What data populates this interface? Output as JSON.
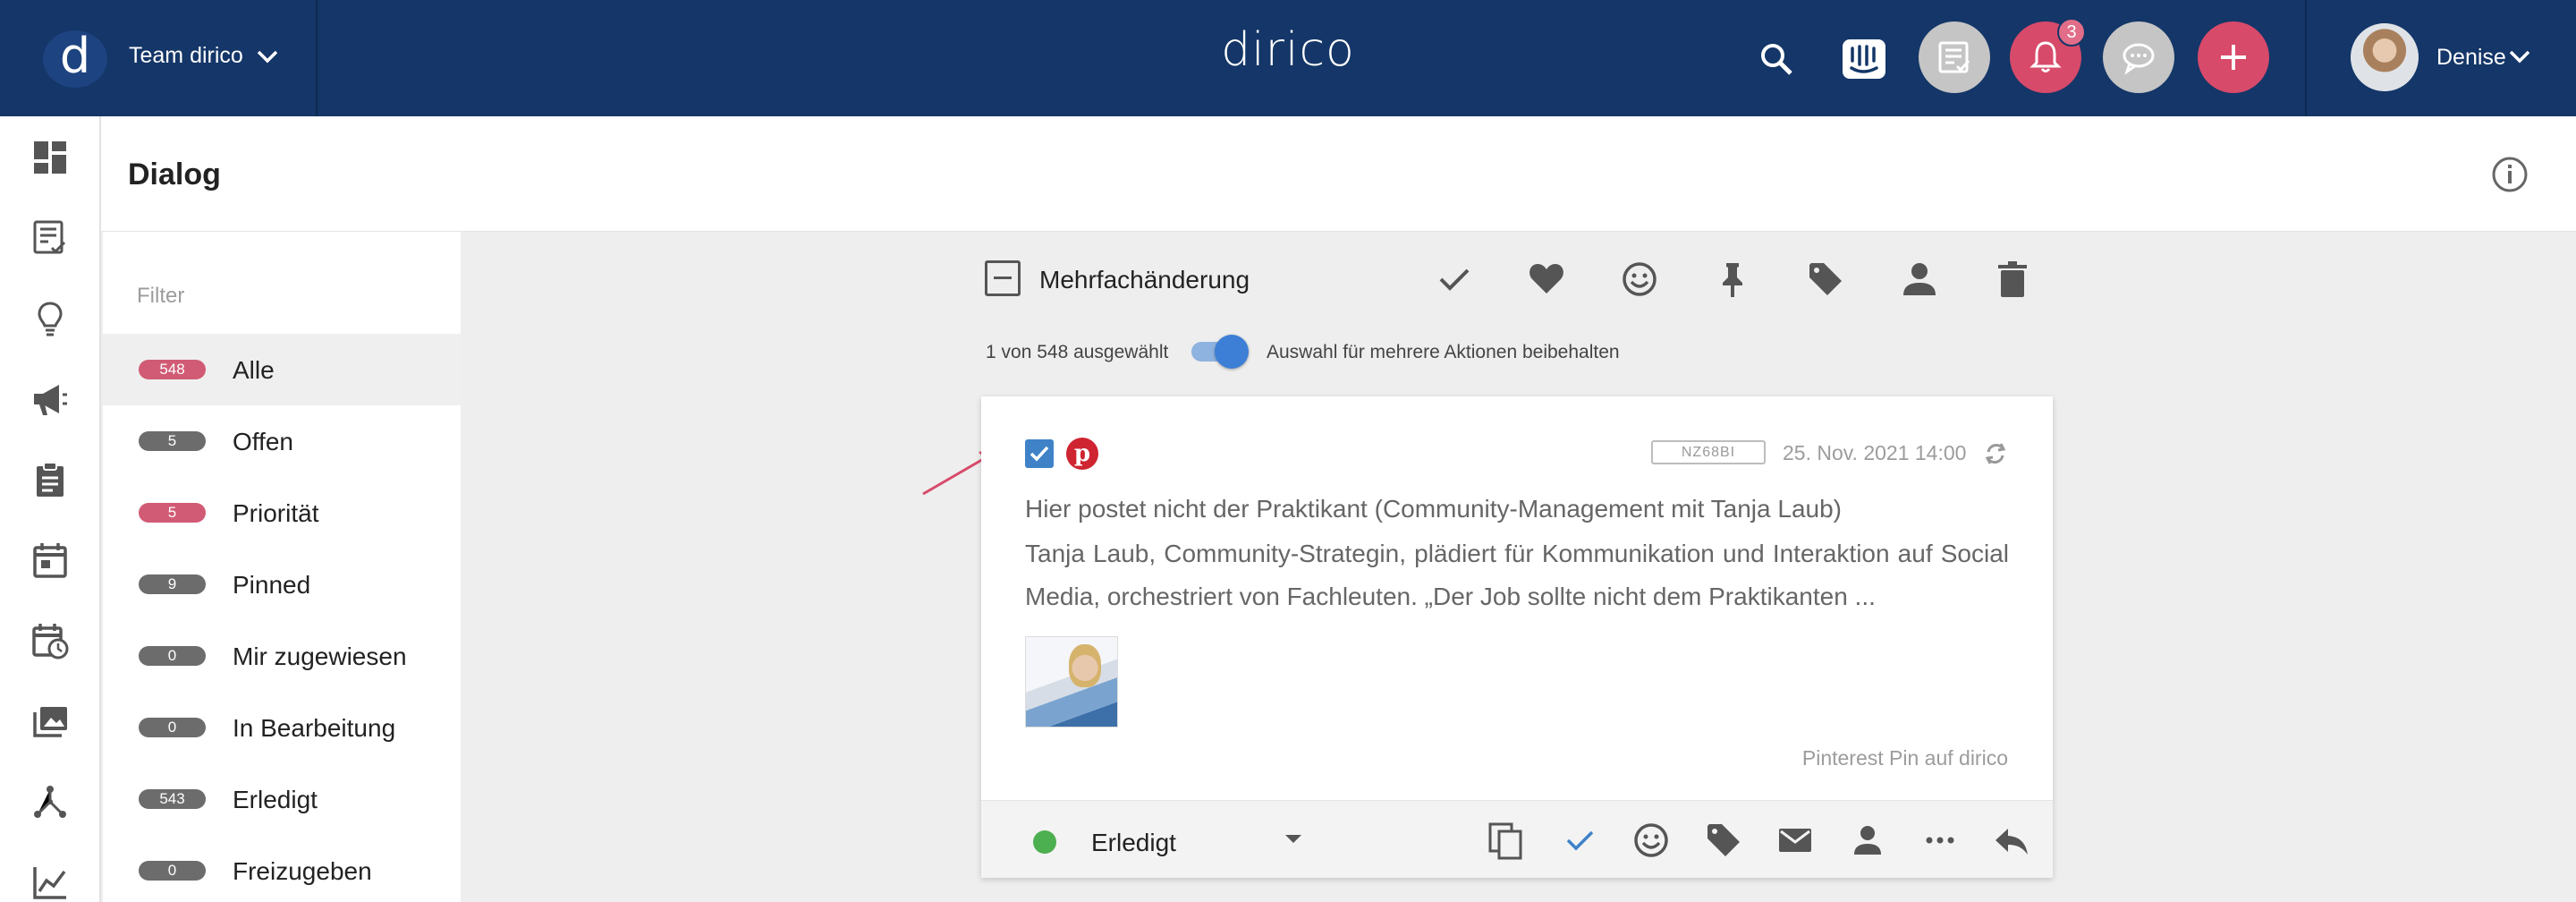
{
  "header": {
    "team_initial": "d",
    "team_name": "Team dirico",
    "brand": "dirico",
    "notification_count": "3",
    "user_name": "Denise"
  },
  "page": {
    "title": "Dialog"
  },
  "filter": {
    "placeholder": "Filter",
    "items": [
      {
        "label": "Alle",
        "count": "548",
        "color": "#d15b74",
        "active": true
      },
      {
        "label": "Offen",
        "count": "5",
        "color": "#6c6c6c"
      },
      {
        "label": "Priorität",
        "count": "5",
        "color": "#d15b74"
      },
      {
        "label": "Pinned",
        "count": "9",
        "color": "#6c6c6c"
      },
      {
        "label": "Mir zugewiesen",
        "count": "0",
        "color": "#6c6c6c"
      },
      {
        "label": "In Bearbeitung",
        "count": "0",
        "color": "#6c6c6c"
      },
      {
        "label": "Erledigt",
        "count": "543",
        "color": "#6c6c6c"
      },
      {
        "label": "Freizugeben",
        "count": "0",
        "color": "#6c6c6c"
      }
    ]
  },
  "bulk": {
    "label": "Mehrfachänderung",
    "selection_info": "1 von 548 ausgewählt",
    "keep_selection_label": "Auswahl für mehrere Aktionen beibehalten",
    "keep_selection_on": true
  },
  "card": {
    "selected": true,
    "network_icon": "pinterest-icon",
    "code": "NZ68BI",
    "date": "25. Nov. 2021 14:00",
    "title": "Hier postet nicht der Praktikant (Community-Management mit Tanja Laub)",
    "body": "Tanja Laub, Community-Strategin, plädiert für Kommunikation und Interaktion auf Social Media, orchestriert von Fachleuten. „Der Job sollte nicht dem Praktikanten ...",
    "source": "Pinterest Pin auf dirico",
    "status": "Erledigt",
    "status_color": "#4caf50"
  },
  "colors": {
    "topbar": "#143668",
    "accent_red": "#d84a6a",
    "accent_blue": "#3d7fd6"
  }
}
